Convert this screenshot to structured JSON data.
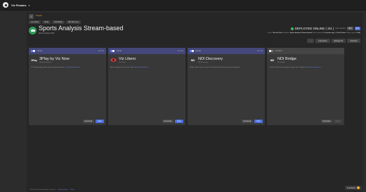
{
  "topbar": {
    "brand": "Viz Flowics"
  },
  "breadcrumb": "Projects",
  "tags": [
    "Viz Library",
    "3Play",
    "NDI Bridge",
    "NDI Discovery"
  ],
  "project": {
    "title": "Sports Analysis Stream-based",
    "subtitle": "Sports Analysis NDI",
    "status": "DEPLOYED ONLINE ( 3/4 )",
    "status_meta": "Last checked",
    "pill_gray": "VPC",
    "pill_blue": "Edit",
    "meta_owner_label": "Owner:",
    "meta_owner": "Russell Lock",
    "meta_template_label": "Template:",
    "meta_template": "Sports Analysis Stream-based",
    "meta_status_label": "Status updated:",
    "meta_status": "9 seconds ago",
    "meta_by_label": "by",
    "meta_by": "Peter Parker",
    "meta_region_label": "Deploy region:",
    "meta_region": "Frnkf"
  },
  "actions": [
    "Instructions",
    "Manage IPs",
    "Shutdown"
  ],
  "cards": [
    {
      "header": "ONLINE",
      "header_right": "ACTIVE",
      "logo": "3Play",
      "name": "3Play by Viz Now",
      "sub": "3Play by Viz Now",
      "desc": "Viz 3Play replay system for live sports production.",
      "link": "Open Remote Access",
      "btn1": "Download",
      "btn2": "Open"
    },
    {
      "header": "ONLINE",
      "header_right": "ACTIVE",
      "logo": "",
      "name": "Viz Libero",
      "sub": "Viz Libero",
      "desc": "Sports analysis tool. Connect with",
      "link": "Open Remote Access",
      "btn1": "Download",
      "btn2": "Open"
    },
    {
      "header": "ONLINE",
      "header_right": "ACTIVE",
      "logo": "NDI",
      "name": "NDI Discovery",
      "sub": "NDI Discovery",
      "desc": "Bridges NDI sources across the network with discovery server registration.",
      "link": "",
      "btn1": "Download",
      "btn2": "Open"
    },
    {
      "header": "STOPPED",
      "header_right": "",
      "logo": "NDI",
      "name": "NDI Bridge",
      "sub": "NDI Bridge",
      "desc": "Connect NDI sources between remote sites. Bridge to",
      "link": "Open Remote Access",
      "btn1": "Download",
      "btn2": "Open"
    }
  ],
  "footer": {
    "copyright": "© 2023 Vizrt Group. All rights reserved.",
    "link1": "Privacy Policy",
    "link2": "Terms"
  },
  "help": {
    "label": "Feedback"
  }
}
